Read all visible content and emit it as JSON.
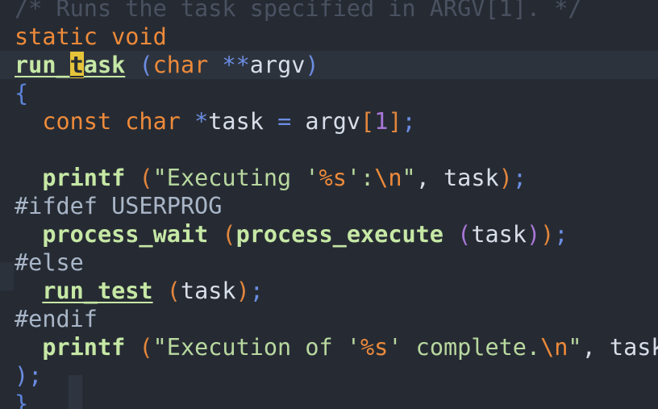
{
  "editor": {
    "lines": [
      {
        "tokens": [
          {
            "t": "/* Runs the task specified in ARGV[1]. */",
            "c": "ghost"
          }
        ]
      },
      {
        "tokens": [
          {
            "t": "static void",
            "c": "kw"
          }
        ]
      },
      {
        "tokens": [
          {
            "t": "run_",
            "c": "fn-u"
          },
          {
            "t": "t",
            "c": "fn-u cursor"
          },
          {
            "t": "ask",
            "c": "fn-u"
          },
          {
            "t": " ",
            "c": "id"
          },
          {
            "t": "(",
            "c": "paren3"
          },
          {
            "t": "char",
            "c": "kw"
          },
          {
            "t": " ",
            "c": "id"
          },
          {
            "t": "**",
            "c": "op"
          },
          {
            "t": "argv",
            "c": "id"
          },
          {
            "t": ")",
            "c": "paren3"
          }
        ],
        "current": true
      },
      {
        "tokens": [
          {
            "t": "{",
            "c": "brace"
          }
        ]
      },
      {
        "tokens": [
          {
            "t": "  ",
            "c": "id"
          },
          {
            "t": "const char",
            "c": "kw"
          },
          {
            "t": " ",
            "c": "id"
          },
          {
            "t": "*",
            "c": "op"
          },
          {
            "t": "task ",
            "c": "id"
          },
          {
            "t": "=",
            "c": "op"
          },
          {
            "t": " argv",
            "c": "id"
          },
          {
            "t": "[",
            "c": "paren"
          },
          {
            "t": "1",
            "c": "num"
          },
          {
            "t": "]",
            "c": "paren"
          },
          {
            "t": ";",
            "c": "op"
          }
        ]
      },
      {
        "tokens": [
          {
            "t": "",
            "c": "id"
          }
        ]
      },
      {
        "tokens": [
          {
            "t": "  ",
            "c": "id"
          },
          {
            "t": "printf",
            "c": "fn"
          },
          {
            "t": " ",
            "c": "id"
          },
          {
            "t": "(",
            "c": "paren"
          },
          {
            "t": "\"Executing '",
            "c": "str"
          },
          {
            "t": "%s",
            "c": "esc"
          },
          {
            "t": "':",
            "c": "str"
          },
          {
            "t": "\\n",
            "c": "esc"
          },
          {
            "t": "\"",
            "c": "str"
          },
          {
            "t": ", task",
            "c": "id"
          },
          {
            "t": ")",
            "c": "paren"
          },
          {
            "t": ";",
            "c": "op"
          }
        ]
      },
      {
        "tokens": [
          {
            "t": "#ifdef USERPROG",
            "c": "pp"
          }
        ]
      },
      {
        "tokens": [
          {
            "t": "  ",
            "c": "id"
          },
          {
            "t": "process_wait",
            "c": "fn"
          },
          {
            "t": " ",
            "c": "id"
          },
          {
            "t": "(",
            "c": "paren"
          },
          {
            "t": "process_execute",
            "c": "fn"
          },
          {
            "t": " ",
            "c": "id"
          },
          {
            "t": "(",
            "c": "paren2"
          },
          {
            "t": "task",
            "c": "id"
          },
          {
            "t": ")",
            "c": "paren2"
          },
          {
            "t": ")",
            "c": "paren"
          },
          {
            "t": ";",
            "c": "op"
          }
        ]
      },
      {
        "tokens": [
          {
            "t": "#else",
            "c": "pp"
          }
        ]
      },
      {
        "tokens": [
          {
            "t": "  ",
            "c": "id"
          },
          {
            "t": "run_test",
            "c": "fn-u"
          },
          {
            "t": " ",
            "c": "id"
          },
          {
            "t": "(",
            "c": "paren"
          },
          {
            "t": "task",
            "c": "id"
          },
          {
            "t": ")",
            "c": "paren"
          },
          {
            "t": ";",
            "c": "op"
          }
        ]
      },
      {
        "tokens": [
          {
            "t": "#endif",
            "c": "pp"
          }
        ]
      },
      {
        "tokens": [
          {
            "t": "  ",
            "c": "id"
          },
          {
            "t": "printf",
            "c": "fn"
          },
          {
            "t": " ",
            "c": "id"
          },
          {
            "t": "(",
            "c": "paren"
          },
          {
            "t": "\"Execution of '",
            "c": "str"
          },
          {
            "t": "%s",
            "c": "esc"
          },
          {
            "t": "' complete.",
            "c": "str"
          },
          {
            "t": "\\n",
            "c": "esc"
          },
          {
            "t": "\"",
            "c": "str"
          },
          {
            "t": ", task",
            "c": "id"
          }
        ]
      },
      {
        "tokens": [
          {
            "t": ")",
            "c": "paren3"
          },
          {
            "t": ";",
            "c": "op"
          }
        ]
      },
      {
        "tokens": [
          {
            "t": "}",
            "c": "brace"
          }
        ]
      }
    ]
  }
}
